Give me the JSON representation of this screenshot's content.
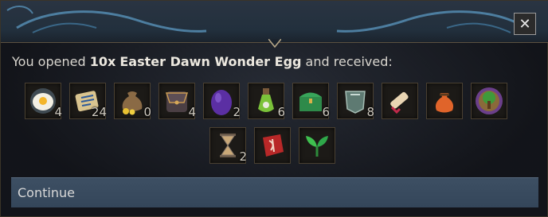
{
  "dialog": {
    "close_label": "✕",
    "message": {
      "prefix": "You opened ",
      "count": "10x",
      "item_name": "Easter Dawn Wonder Egg",
      "suffix": " and received:"
    },
    "continue_label": "Continue"
  },
  "rewards_row1": [
    {
      "icon": "fried-egg-icon",
      "qty": "4"
    },
    {
      "icon": "scroll-map-icon",
      "qty": "24"
    },
    {
      "icon": "gold-sack-icon",
      "qty": "0"
    },
    {
      "icon": "leather-satchel-icon",
      "qty": "4"
    },
    {
      "icon": "purple-egg-icon",
      "qty": "2"
    },
    {
      "icon": "poison-potion-icon",
      "qty": "6"
    },
    {
      "icon": "treasure-chest-icon",
      "qty": "6"
    },
    {
      "icon": "armor-plate-icon",
      "qty": "8"
    },
    {
      "icon": "magic-scroll-icon",
      "qty": ""
    },
    {
      "icon": "orange-pouch-icon",
      "qty": ""
    },
    {
      "icon": "tree-emblem-icon",
      "qty": ""
    }
  ],
  "rewards_row2": [
    {
      "icon": "hourglass-icon",
      "qty": "2"
    },
    {
      "icon": "red-rune-stone-icon",
      "qty": ""
    },
    {
      "icon": "green-sprout-icon",
      "qty": ""
    }
  ]
}
